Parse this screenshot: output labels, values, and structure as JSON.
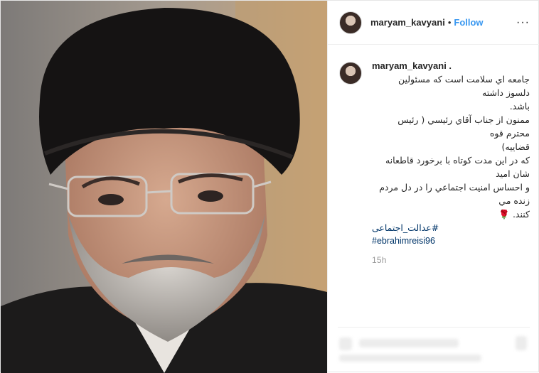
{
  "header": {
    "username": "maryam_kavyani",
    "separator": "•",
    "follow_label": "Follow",
    "more_label": "···"
  },
  "caption": {
    "username": "maryam_kavyani .",
    "lines": [
      "جامعه اي سلامت است كه مسئولين دلسوز داشته",
      "باشد.",
      "ممنون از جناب آقاي رئيسي ( رئيس محترم قوه",
      "قضاييه)",
      "كه در اين مدت كوتاه با برخورد قاطعانه شان اميد",
      "و احساس امنيت اجتماعي را در دل مردم زنده مي",
      "كنند. 🌹"
    ],
    "hashtags": [
      "#عدالت_اجتماعی",
      "#ebrahimreisi96"
    ],
    "time": "15h"
  },
  "colors": {
    "link": "#3897f0",
    "hashtag": "#003569",
    "muted": "#999999",
    "text": "#262626"
  }
}
